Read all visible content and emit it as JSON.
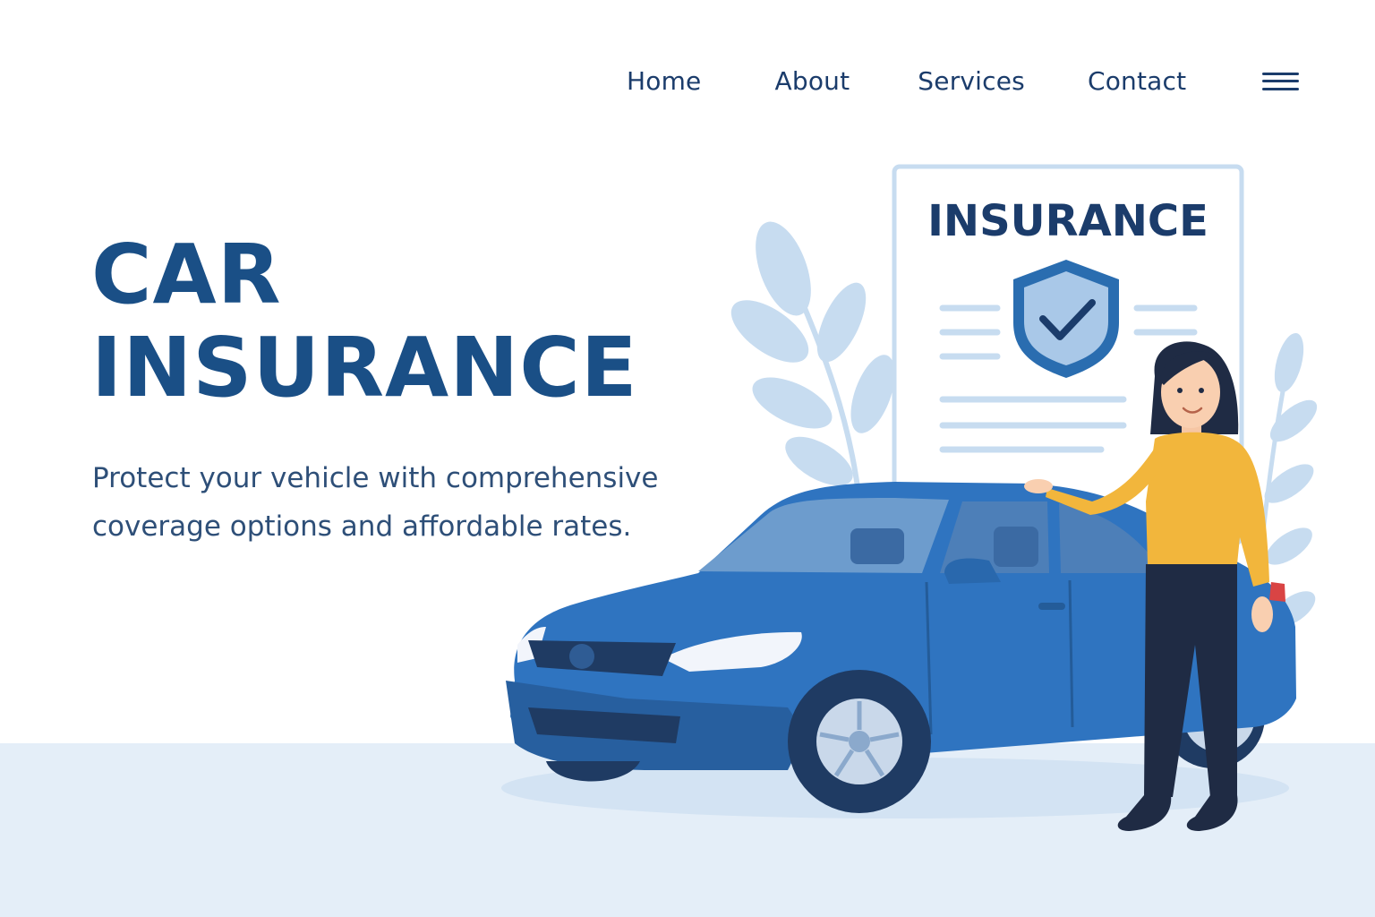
{
  "nav": {
    "items": [
      "Home",
      "About",
      "Services",
      "Contact"
    ],
    "menu_icon": "hamburger-menu-icon"
  },
  "hero": {
    "title_line1": "CAR",
    "title_line2": "INSURANCE",
    "subtitle": "Protect your vehicle with comprehensive coverage options and affordable rates."
  },
  "illustration": {
    "document_title": "INSURANCE",
    "shield_icon": "shield-check-icon"
  },
  "colors": {
    "primary": "#1a4f86",
    "nav_text": "#1b3c6b",
    "car_body": "#2f74c0",
    "shirt": "#f2b63c",
    "ground": "#e4eef8",
    "leaf": "#c7dcf0"
  }
}
